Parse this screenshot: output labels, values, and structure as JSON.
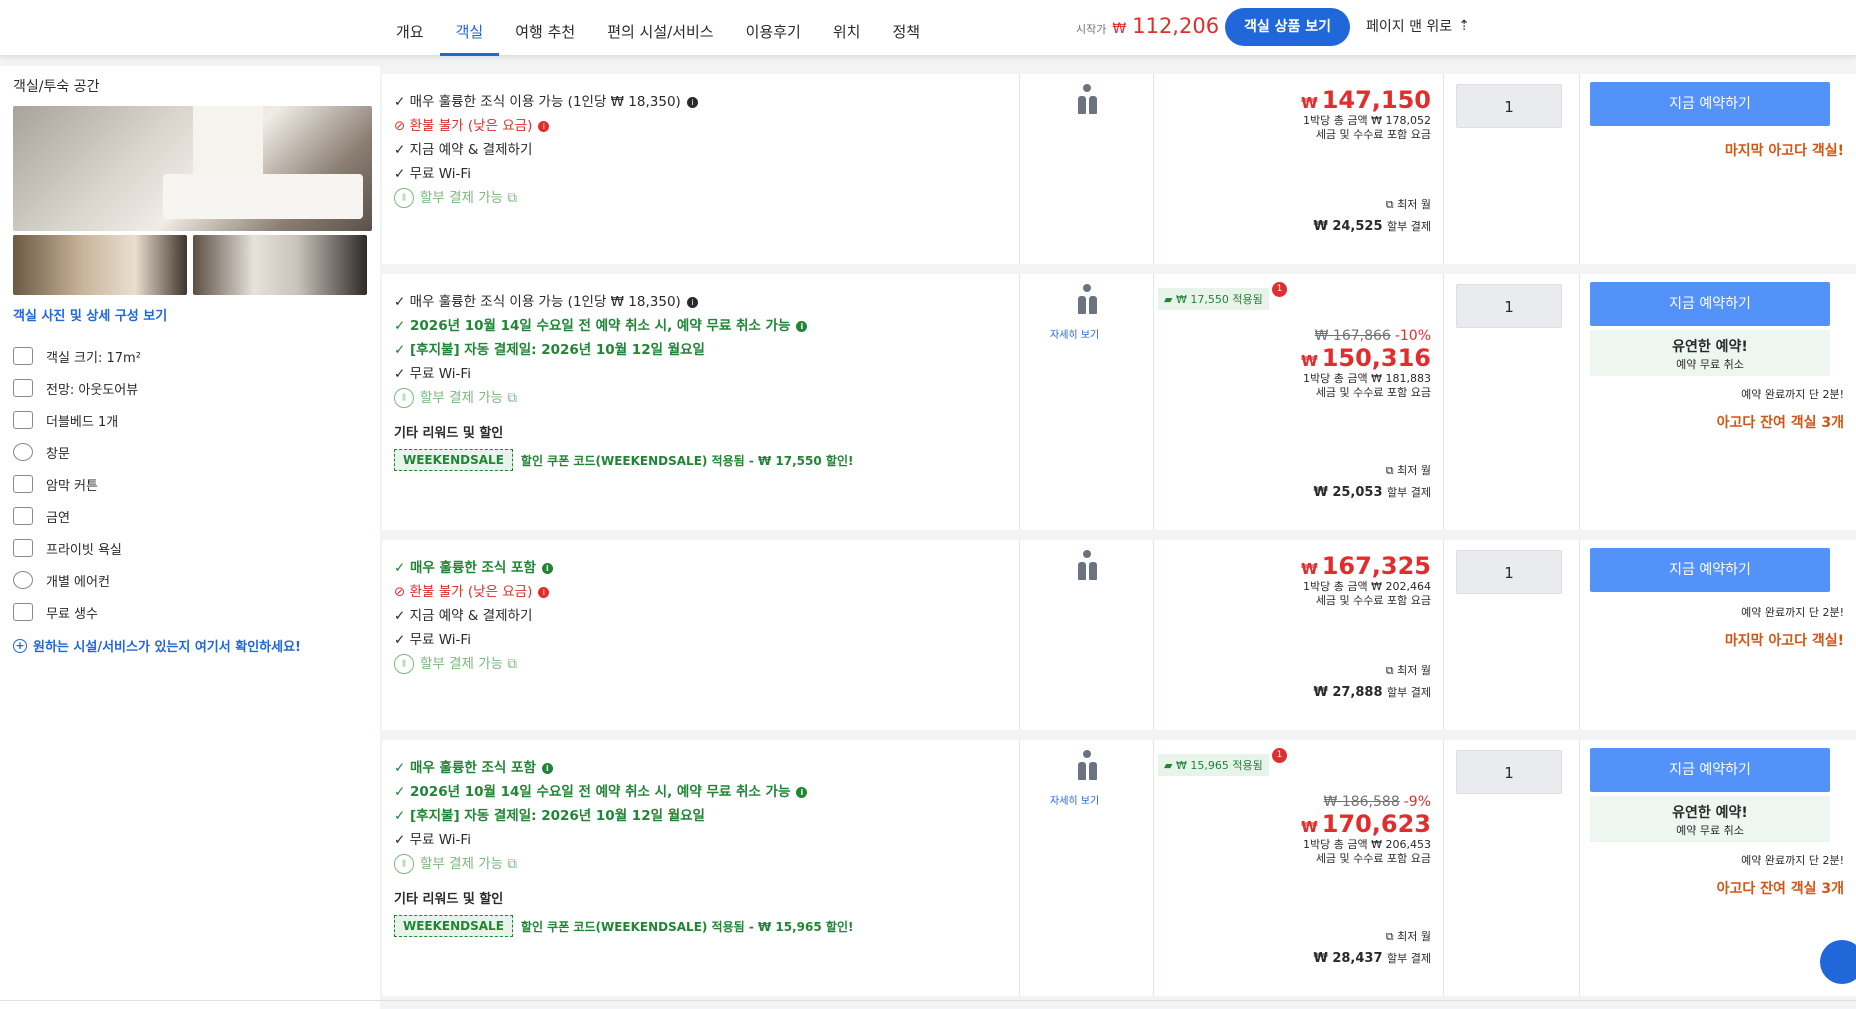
{
  "nav": {
    "tabs": [
      "개요",
      "객실",
      "여행 추천",
      "편의 시설/서비스",
      "이용후기",
      "위치",
      "정책"
    ],
    "active_tab": "객실",
    "start_label": "시작가",
    "start_currency": "₩",
    "start_price": "112,206",
    "view_button": "객실 상품 보기",
    "top_link": "페이지 맨 위로"
  },
  "room": {
    "title": "객실/투숙 공간",
    "photo_link": "객실 사진 및 상세 구성 보기",
    "amenities": [
      "객실 크기: 17m²",
      "전망: 아웃도어뷰",
      "더블베드 1개",
      "창문",
      "암막 커튼",
      "금연",
      "프라이빗 욕실",
      "개별 에어컨",
      "무료 생수"
    ],
    "more_link": "원하는 시설/서비스가 있는지 여기서 확인하세요!"
  },
  "offers": [
    {
      "features": [
        {
          "text": "✓ 매우 훌륭한 조식 이용 가능 (1인당 ₩ 18,350)",
          "style": "black",
          "info": "black"
        },
        {
          "text": "⊘ 환불 불가 (낮은 요금)",
          "style": "red",
          "info": "red"
        },
        {
          "text": "✓ 지금 예약 & 결제하기",
          "style": "black"
        },
        {
          "text": "✓ 무료 Wi-Fi",
          "style": "black"
        },
        {
          "text": "할부 결제 가능 ⧉",
          "style": "gray",
          "inst": true
        }
      ],
      "price": "147,150",
      "total": "1박당 총 금액 ₩ 178,052",
      "tax": "세금 및 수수료 포함 요금",
      "inst_label": "⧉ 최저 월",
      "inst_value": "₩ 24,525",
      "inst_suffix": "할부 결제",
      "qty": "1",
      "book": "지금 예약하기",
      "notice": "마지막 아고다 객실!"
    },
    {
      "features": [
        {
          "text": "✓ 매우 훌륭한 조식 이용 가능 (1인당 ₩ 18,350)",
          "style": "black",
          "info": "black"
        },
        {
          "text": "✓ 2026년 10월 14일 수요일 전 예약 취소 시, 예약 무료 취소 가능",
          "style": "green",
          "info": "green"
        },
        {
          "text": "✓ [후지불] 자동 결제일: 2026년 10월 12일 월요일",
          "style": "green"
        },
        {
          "text": "✓ 무료 Wi-Fi",
          "style": "black"
        },
        {
          "text": "할부 결제 가능 ⧉",
          "style": "gray",
          "inst": true
        }
      ],
      "other_title": "기타 리워드 및 할인",
      "coupon_tag": "WEEKENDSALE",
      "coupon_text": "할인 쿠폰 코드(WEEKENDSALE) 적용됨 - ₩ 17,550 할인!",
      "detail_link": "자세히 보기",
      "promo": "₩ 17,550 적용됨",
      "promo_count": "1",
      "original": "₩ 167,866",
      "discount": "-10%",
      "price": "150,316",
      "total": "1박당 총 금액 ₩ 181,883",
      "tax": "세금 및 수수료 포함 요금",
      "inst_label": "⧉ 최저 월",
      "inst_value": "₩ 25,053",
      "inst_suffix": "할부 결제",
      "qty": "1",
      "book": "지금 예약하기",
      "flex_title": "유연한 예약!",
      "flex_sub": "예약 무료 취소",
      "countdown": "예약 완료까지 단 2분!",
      "notice": "아고다 잔여 객실 3개"
    },
    {
      "features": [
        {
          "text": "✓ 매우 훌륭한 조식 포함",
          "style": "green",
          "info": "green"
        },
        {
          "text": "⊘ 환불 불가 (낮은 요금)",
          "style": "red",
          "info": "red"
        },
        {
          "text": "✓ 지금 예약 & 결제하기",
          "style": "black"
        },
        {
          "text": "✓ 무료 Wi-Fi",
          "style": "black"
        },
        {
          "text": "할부 결제 가능 ⧉",
          "style": "gray",
          "inst": true
        }
      ],
      "price": "167,325",
      "total": "1박당 총 금액 ₩ 202,464",
      "tax": "세금 및 수수료 포함 요금",
      "inst_label": "⧉ 최저 월",
      "inst_value": "₩ 27,888",
      "inst_suffix": "할부 결제",
      "qty": "1",
      "book": "지금 예약하기",
      "countdown": "예약 완료까지 단 2분!",
      "notice": "마지막 아고다 객실!"
    },
    {
      "features": [
        {
          "text": "✓ 매우 훌륭한 조식 포함",
          "style": "green",
          "info": "green"
        },
        {
          "text": "✓ 2026년 10월 14일 수요일 전 예약 취소 시, 예약 무료 취소 가능",
          "style": "green",
          "info": "green"
        },
        {
          "text": "✓ [후지불] 자동 결제일: 2026년 10월 12일 월요일",
          "style": "green"
        },
        {
          "text": "✓ 무료 Wi-Fi",
          "style": "black"
        },
        {
          "text": "할부 결제 가능 ⧉",
          "style": "gray",
          "inst": true
        }
      ],
      "other_title": "기타 리워드 및 할인",
      "coupon_tag": "WEEKENDSALE",
      "coupon_text": "할인 쿠폰 코드(WEEKENDSALE) 적용됨 - ₩ 15,965 할인!",
      "detail_link": "자세히 보기",
      "promo": "₩ 15,965 적용됨",
      "promo_count": "1",
      "original": "₩ 186,588",
      "discount": "-9%",
      "price": "170,623",
      "total": "1박당 총 금액 ₩ 206,453",
      "tax": "세금 및 수수료 포함 요금",
      "inst_label": "⧉ 최저 월",
      "inst_value": "₩ 28,437",
      "inst_suffix": "할부 결제",
      "qty": "1",
      "book": "지금 예약하기",
      "flex_title": "유연한 예약!",
      "flex_sub": "예약 무료 취소",
      "countdown": "예약 완료까지 단 2분!",
      "notice": "아고다 잔여 객실 3개"
    }
  ],
  "currency": "₩"
}
